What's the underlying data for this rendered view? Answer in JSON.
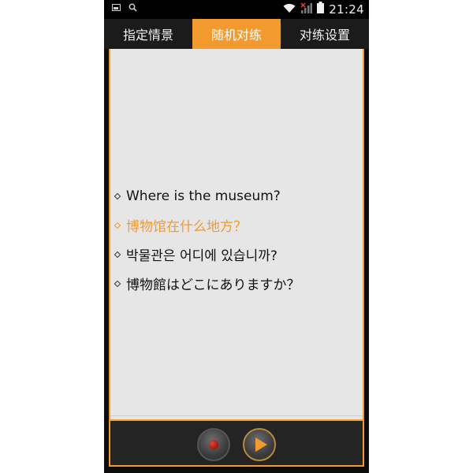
{
  "status_bar": {
    "time": "21:24",
    "icons": [
      "gallery-icon",
      "search-icon",
      "wifi-icon",
      "signal-icon",
      "battery-icon"
    ]
  },
  "tabs": [
    {
      "label": "指定情景",
      "active": false
    },
    {
      "label": "随机对练",
      "active": true
    },
    {
      "label": "对练设置",
      "active": false
    }
  ],
  "phrases": {
    "english": "Where is the museum?",
    "chinese": "博物馆在什么地方？",
    "korean": "박물관은 어디에 있습니까?",
    "japanese": "博物館はどこにありますか？"
  },
  "controls": {
    "record_icon": "record-icon",
    "play_icon": "play-icon"
  },
  "colors": {
    "accent": "#f29a2e",
    "background": "#0d0d0d",
    "panel": "#e6e6e6"
  }
}
